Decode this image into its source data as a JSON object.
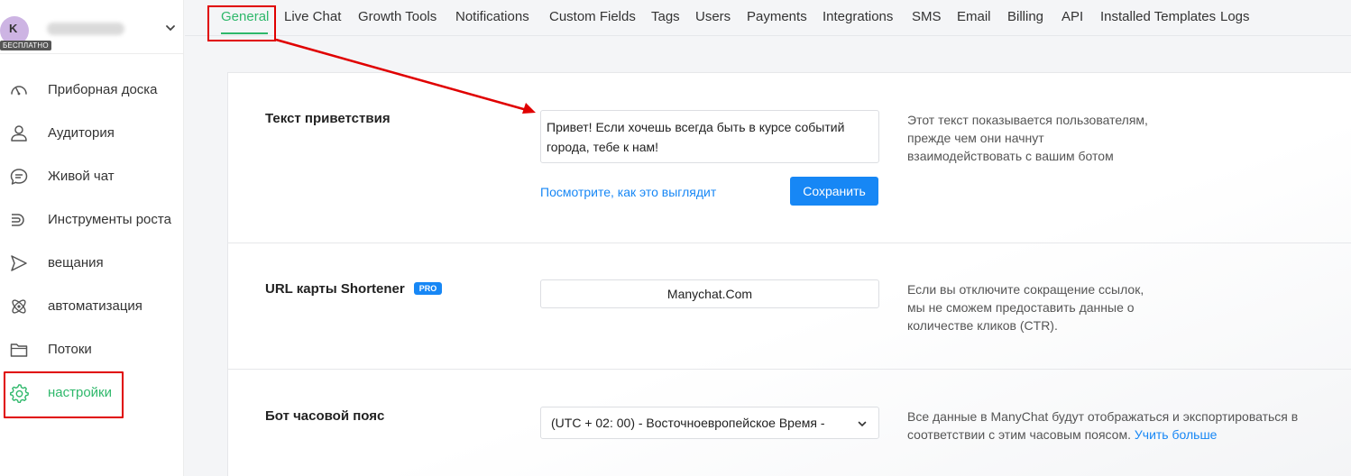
{
  "account": {
    "avatar_letter": "K",
    "plan_badge": "БЕСПЛАТНО",
    "name_blurred": ""
  },
  "sidebar": {
    "items": [
      {
        "label": "Приборная доска",
        "icon": "dashboard-gauge-icon"
      },
      {
        "label": "Аудитория",
        "icon": "user-icon"
      },
      {
        "label": "Живой чат",
        "icon": "chat-bubble-icon"
      },
      {
        "label": "Инструменты роста",
        "icon": "magnet-icon"
      },
      {
        "label": "вещания",
        "icon": "send-arrow-icon"
      },
      {
        "label": "автоматизация",
        "icon": "atom-icon"
      },
      {
        "label": "Потоки",
        "icon": "folder-icon"
      },
      {
        "label": "настройки",
        "icon": "gear-icon",
        "active": true
      }
    ]
  },
  "tabs": [
    {
      "label": "General",
      "active": true
    },
    {
      "label": "Live Chat"
    },
    {
      "label": "Growth Tools"
    },
    {
      "label": "Notifications"
    },
    {
      "label": "Custom Fields"
    },
    {
      "label": "Tags"
    },
    {
      "label": "Users"
    },
    {
      "label": "Payments"
    },
    {
      "label": "Integrations"
    },
    {
      "label": "SMS"
    },
    {
      "label": "Email"
    },
    {
      "label": "Billing"
    },
    {
      "label": "API"
    },
    {
      "label": "Installed Templates"
    },
    {
      "label": "Logs"
    }
  ],
  "greeting": {
    "label": "Текст приветствия",
    "value_line1": "Привет! Если хочешь всегда быть в курсе событий",
    "value_line2": "города, тебе к нам!",
    "preview_link": "Посмотрите, как это выглядит",
    "save_button": "Сохранить",
    "description": "Этот текст показывается пользователям, прежде чем они начнут взаимодействовать с вашим ботом"
  },
  "shortener": {
    "label": "URL карты Shortener",
    "badge": "PRO",
    "value": "Manychat.Com",
    "description": "Если вы отключите сокращение ссылок, мы не сможем предоставить данные о количестве кликов (CTR)."
  },
  "timezone": {
    "label": "Бот часовой пояс",
    "value": "(UTC + 02: 00) - Восточноевропейское Время -",
    "description": "Все данные в ManyChat будут отображаться и экспортироваться в соответствии с этим часовым поясом.",
    "learn_more": "Учить больше"
  },
  "colors": {
    "accent_green": "#2fb86b",
    "primary_blue": "#1787f5",
    "annotation_red": "#e00000"
  }
}
